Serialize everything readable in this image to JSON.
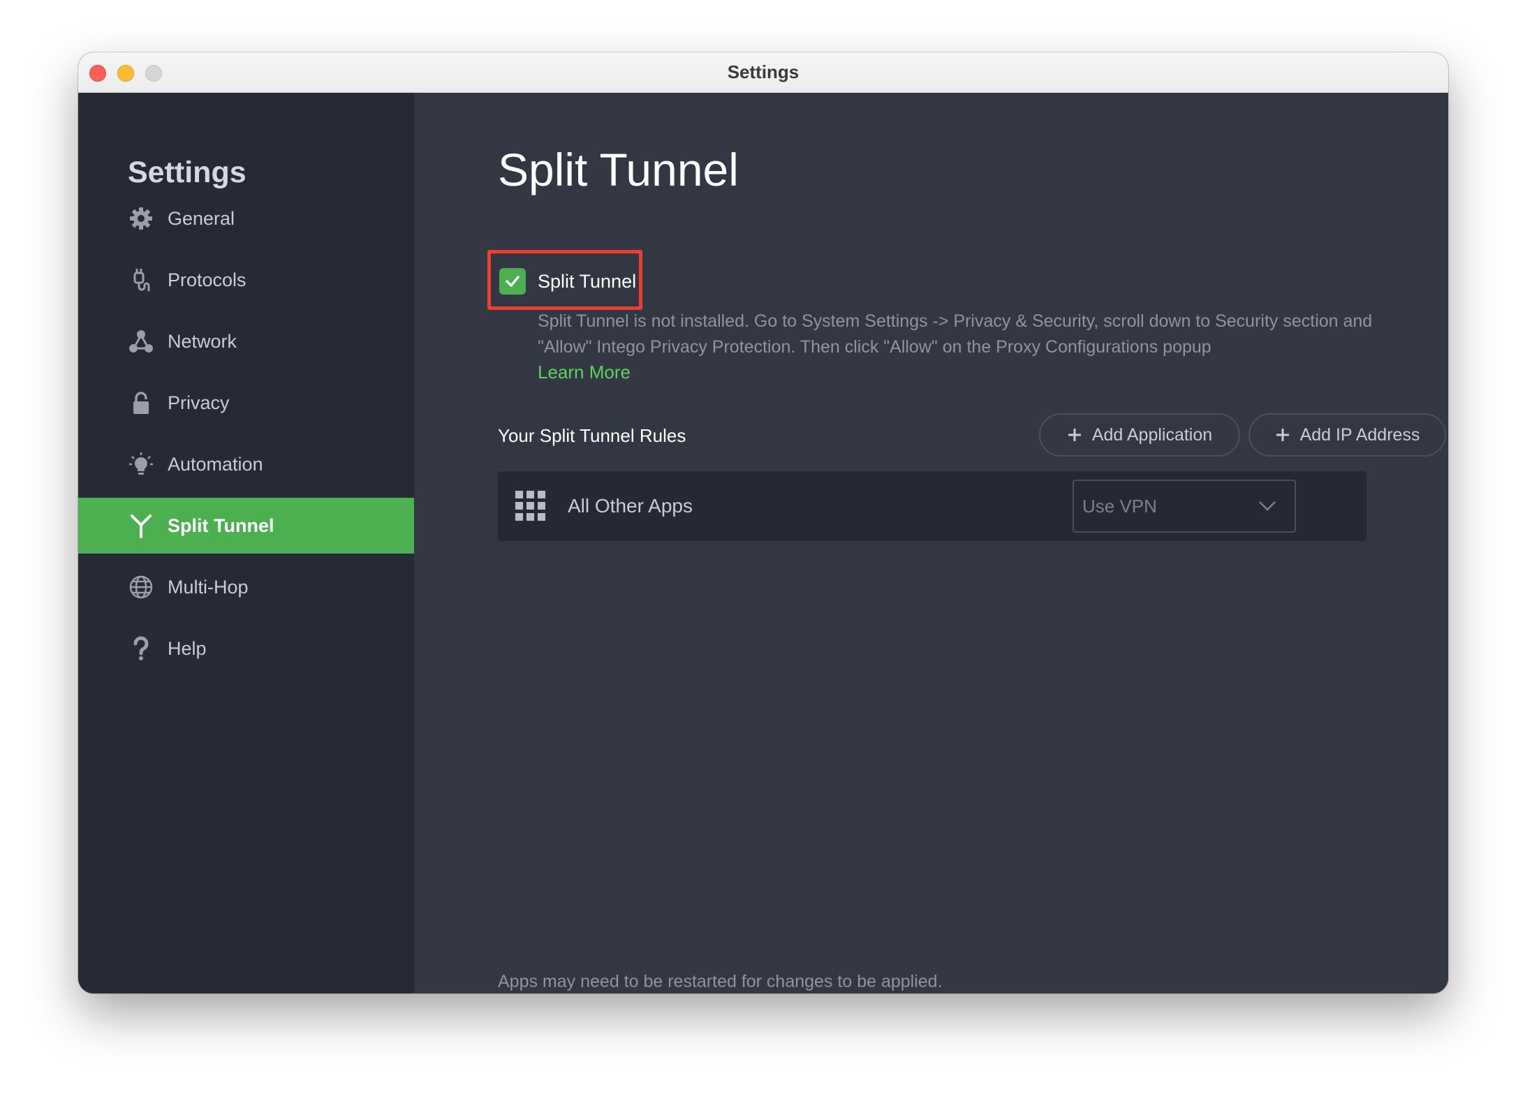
{
  "window": {
    "title": "Settings"
  },
  "sidebar": {
    "title": "Settings",
    "items": [
      {
        "label": "General",
        "icon": "gear-icon"
      },
      {
        "label": "Protocols",
        "icon": "plug-icon"
      },
      {
        "label": "Network",
        "icon": "network-icon"
      },
      {
        "label": "Privacy",
        "icon": "lock-icon"
      },
      {
        "label": "Automation",
        "icon": "lightbulb-icon"
      },
      {
        "label": "Split Tunnel",
        "icon": "split-icon",
        "active": true
      },
      {
        "label": "Multi-Hop",
        "icon": "globe-icon"
      },
      {
        "label": "Help",
        "icon": "question-icon"
      }
    ]
  },
  "main": {
    "title": "Split Tunnel",
    "toggle": {
      "label": "Split Tunnel",
      "checked": true
    },
    "notice": "Split Tunnel is not installed. Go to System Settings -> Privacy & Security, scroll down to Security section and \"Allow\" Intego Privacy Protection. Then click \"Allow\" on the Proxy Configurations popup",
    "learn_more": "Learn More",
    "rules_title": "Your Split Tunnel Rules",
    "add_application": "Add Application",
    "add_ip": "Add IP Address",
    "rule": {
      "name": "All Other Apps",
      "mode": "Use VPN"
    },
    "footer": "Apps may need to be restarted for changes to be applied."
  },
  "colors": {
    "accent": "#4caf50",
    "sidebar_bg": "#262a36",
    "content_bg": "#333744",
    "highlight": "#e8412d",
    "link": "#5fd35f"
  }
}
